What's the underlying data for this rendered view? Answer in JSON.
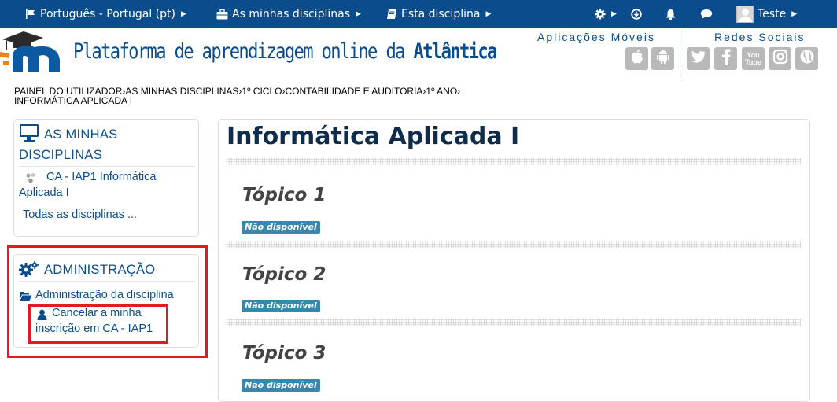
{
  "topnav": {
    "language": "Português - Portugal (pt)",
    "my_courses": "As minhas disciplinas",
    "this_course": "Esta disciplina",
    "user_name": "Teste",
    "icons": [
      "flag-icon",
      "briefcase-icon",
      "book-icon",
      "gear-icon",
      "download-icon",
      "bell-icon",
      "chat-icon"
    ]
  },
  "header": {
    "site_title_prefix": "Plataforma de aprendizagem online da ",
    "site_title_brand": "Atlântica",
    "mobile_apps_label": "Aplicações Móveis",
    "social_label": "Redes Sociais",
    "youtube_top": "You",
    "youtube_bottom": "Tube"
  },
  "breadcrumb": [
    "PAINEL DO UTILIZADOR",
    "AS MINHAS DISCIPLINAS",
    "1º CICLO",
    "CONTABILIDADE E AUDITORIA",
    "1º ANO",
    "INFORMÁTICA APLICADA I"
  ],
  "my_courses_block": {
    "title_line1": "AS MINHAS",
    "title_line2": "DISCIPLINAS",
    "course_line1": "CA - IAP1 Informática",
    "course_line2": "Aplicada I",
    "all_courses": "Todas as disciplinas ..."
  },
  "admin_block": {
    "title": "ADMINISTRAÇÃO",
    "course_admin": "Administração da disciplina",
    "unenrol_line1": "Cancelar a minha",
    "unenrol_line2": "inscrição em CA - IAP1"
  },
  "main": {
    "course_title": "Informática Aplicada I",
    "topics": [
      {
        "name": "Tópico 1",
        "status": "Não disponível"
      },
      {
        "name": "Tópico 2",
        "status": "Não disponível"
      },
      {
        "name": "Tópico 3",
        "status": "Não disponível"
      }
    ]
  },
  "colors": {
    "nav_bg": "#0b4d8c",
    "link": "#0b4d8c",
    "badge": "#3a87ad",
    "highlight": "#e21b23"
  }
}
